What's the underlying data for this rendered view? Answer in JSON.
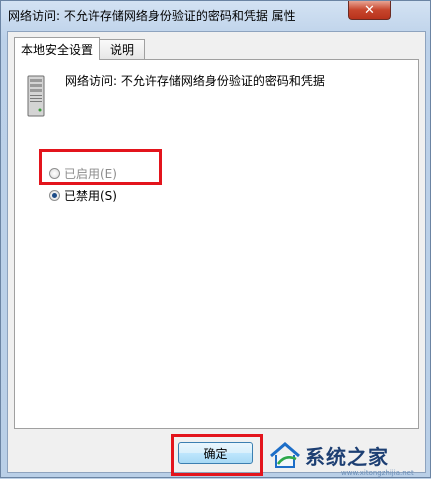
{
  "window": {
    "title": "网络访问: 不允许存储网络身份验证的密码和凭据 属性",
    "close_label": "✕"
  },
  "tabs": [
    {
      "label": "本地安全设置",
      "active": true
    },
    {
      "label": "说明",
      "active": false
    }
  ],
  "policy": {
    "name": "网络访问: 不允许存储网络身份验证的密码和凭据",
    "icon": "server-icon"
  },
  "options": [
    {
      "label": "已启用(E)",
      "selected": false
    },
    {
      "label": "已禁用(S)",
      "selected": true
    }
  ],
  "buttons": {
    "ok_label": "确定"
  },
  "watermark": {
    "text": "系统之家",
    "url": "www.xitongzhijia.net"
  },
  "colors": {
    "highlight": "#e3141c",
    "radio_selected": "#1c4b87"
  }
}
